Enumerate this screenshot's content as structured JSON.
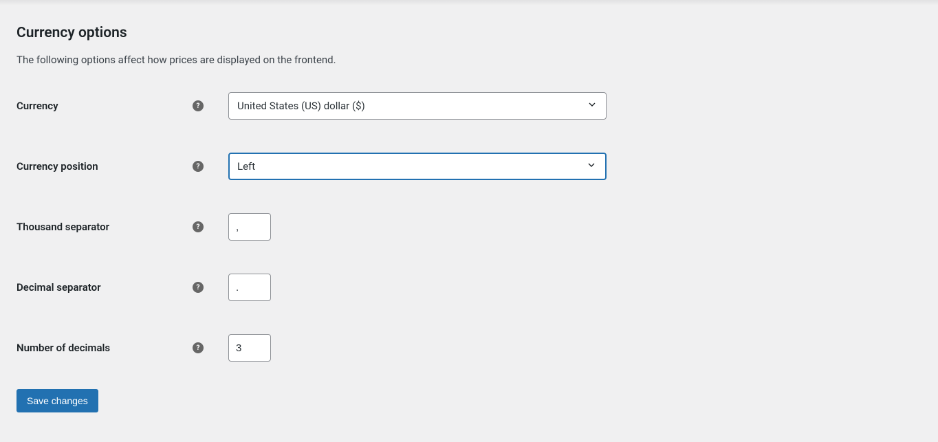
{
  "section": {
    "title": "Currency options",
    "description": "The following options affect how prices are displayed on the frontend."
  },
  "fields": {
    "currency": {
      "label": "Currency",
      "value": "United States (US) dollar ($)"
    },
    "currency_position": {
      "label": "Currency position",
      "value": "Left"
    },
    "thousand_separator": {
      "label": "Thousand separator",
      "value": ","
    },
    "decimal_separator": {
      "label": "Decimal separator",
      "value": "."
    },
    "number_of_decimals": {
      "label": "Number of decimals",
      "value": "3"
    }
  },
  "buttons": {
    "save": "Save changes"
  },
  "help_glyph": "?"
}
